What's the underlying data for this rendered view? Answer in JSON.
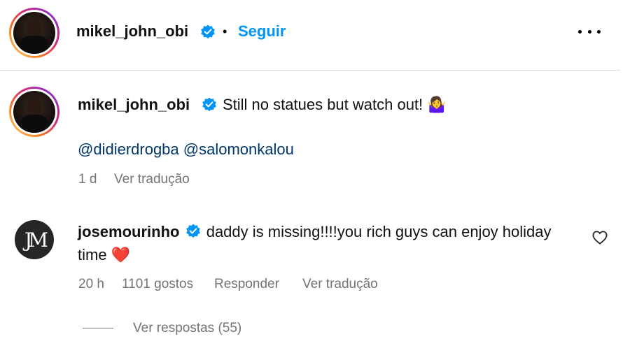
{
  "header": {
    "username": "mikel_john_obi",
    "separator": "•",
    "follow_label": "Seguir"
  },
  "caption": {
    "username": "mikel_john_obi",
    "text": "Still no statues but watch out! 🤷‍♀️",
    "mentions": "@didierdrogba @salomonkalou",
    "time": "1 d",
    "translate_label": "Ver tradução"
  },
  "comment": {
    "username": "josemourinho",
    "text": "daddy is missing!!!!you rich guys can enjoy holiday time ❤️",
    "time": "20 h",
    "likes": "1101 gostos",
    "reply_label": "Responder",
    "translate_label": "Ver tradução",
    "view_replies_label": "Ver respostas (55)"
  },
  "icons": {
    "verified": "verified-badge-icon",
    "more": "more-options-icon",
    "like": "heart-outline-icon"
  },
  "colors": {
    "accent": "#0095f6",
    "verified": "#0095f6",
    "mention": "#00376b",
    "secondary_text": "#737373",
    "heart": "#e0245e"
  }
}
